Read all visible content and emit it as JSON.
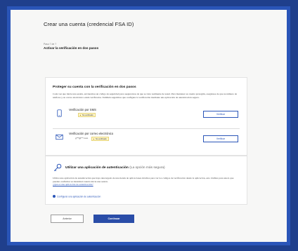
{
  "page": {
    "title": "Crear una cuenta (credencial FSA ID)",
    "step": "Paso 7 de 7",
    "step_title": "Activar la verificación en dos pasos"
  },
  "two_step": {
    "heading": "Proteger su cuenta con la verificación en dos pasos",
    "description": "Cada vez que inicie una sesión, enviaremos un código de seguridad para asegurarnos de que se trata realmente de usted. Para mantener su cuenta protegida, asegúrese de que su número de teléfono y su correo electrónico estén verificados. También sugerimos que configure la verificación mediante una aplicación de autenticación segura.",
    "sms": {
      "label": "Verificación por SMS",
      "badge": "No verificado",
      "button": "Verificar",
      "icon": "phone-icon"
    },
    "email": {
      "label": "Verificación por correo electrónico",
      "value": "g***@***.com",
      "badge": "No verificado",
      "button": "Verificar",
      "icon": "envelope-icon"
    }
  },
  "auth_app": {
    "heading": "Utilizar una aplicación de autenticación",
    "note": "(La opción más segura)",
    "description": "Utilice una aplicación de autenticación que haya descargado de una tienda de aplicaciones móviles para ver los códigos de verificación desde la aplicación, esto visibles para usted, que pueden confirmar su identidad cuando inicie una sesión.",
    "link": "¿Qué es una aplicación de autenticación?",
    "configure": "Configurar una aplicación de autenticación",
    "icon": "key-icon"
  },
  "actions": {
    "back": "Anterior",
    "continue": "Continuar"
  },
  "colors": {
    "background": "#1f3f8c",
    "frame": "#2a55b8",
    "primary": "#2a4da8",
    "warning_badge": "#fff6c7"
  }
}
